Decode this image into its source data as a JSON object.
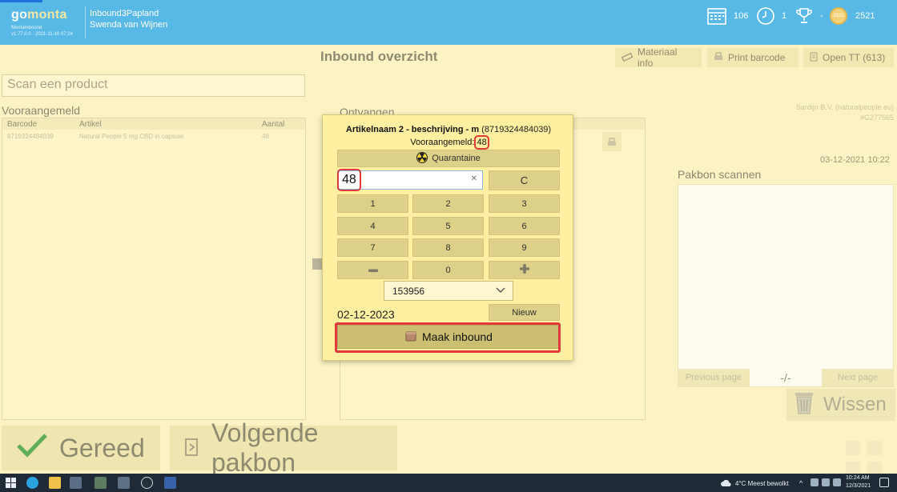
{
  "header": {
    "brand_go": "go",
    "brand_monta": "monta",
    "brand_sub1": "MontaInbound",
    "brand_sub2": "v1.77.0.0 · 2021-11-16 07:24",
    "station": "Inbound3Papland",
    "user": "Swenda van Wijnen",
    "stat_calendar": "106",
    "stat_clock": "1",
    "stat_trophy": "-",
    "stat_coin_icon_text": "2521",
    "stat_coins": "2521"
  },
  "page": {
    "title": "Inbound overzicht",
    "btn_materiaal": "Materiaal info",
    "btn_print": "Print barcode",
    "btn_open_tt": "Open TT (613)",
    "scan_placeholder": "Scan een product",
    "vooraangemeld_label": "Vooraangemeld",
    "ontvangen_label": "Ontvangen",
    "col_barcode": "Barcode",
    "col_artikel": "Artikel",
    "col_aantal": "Aantal",
    "row_barcode": "8719324484039",
    "row_artikel": "Natural People 5 mg CBD in capsule",
    "row_aantal": "48",
    "supplier_line1": "Sardijn B.V. (naturalpeople.eu)",
    "supplier_line2": "#G277565",
    "date_time": "03-12-2021 10:22",
    "pakbon_label": "Pakbon scannen",
    "previous_page": "Previous page",
    "page_counter": "-/-",
    "next_page": "Next page",
    "wissen": "Wissen",
    "gereed": "Gereed",
    "volgende_pakbon": "Volgende pakbon"
  },
  "dialog": {
    "title": "Artikelnaam 2 - beschrijving - m",
    "code": "(8719324484039)",
    "vooraangemeld_label": "Vooraangemeld:",
    "vooraangemeld_value": "48",
    "quarantaine": "Quarantaine",
    "amount": "48",
    "clear": "C",
    "keys": [
      "1",
      "2",
      "3",
      "4",
      "5",
      "6",
      "7",
      "8",
      "9"
    ],
    "zero": "0",
    "batch": "153956",
    "expiry": "02-12-2023",
    "nieuw": "Nieuw",
    "maak_inbound": "Maak inbound"
  },
  "taskbar": {
    "weather": "4°C  Meest bewolkt",
    "time": "10:24 AM",
    "date": "12/3/2021"
  }
}
